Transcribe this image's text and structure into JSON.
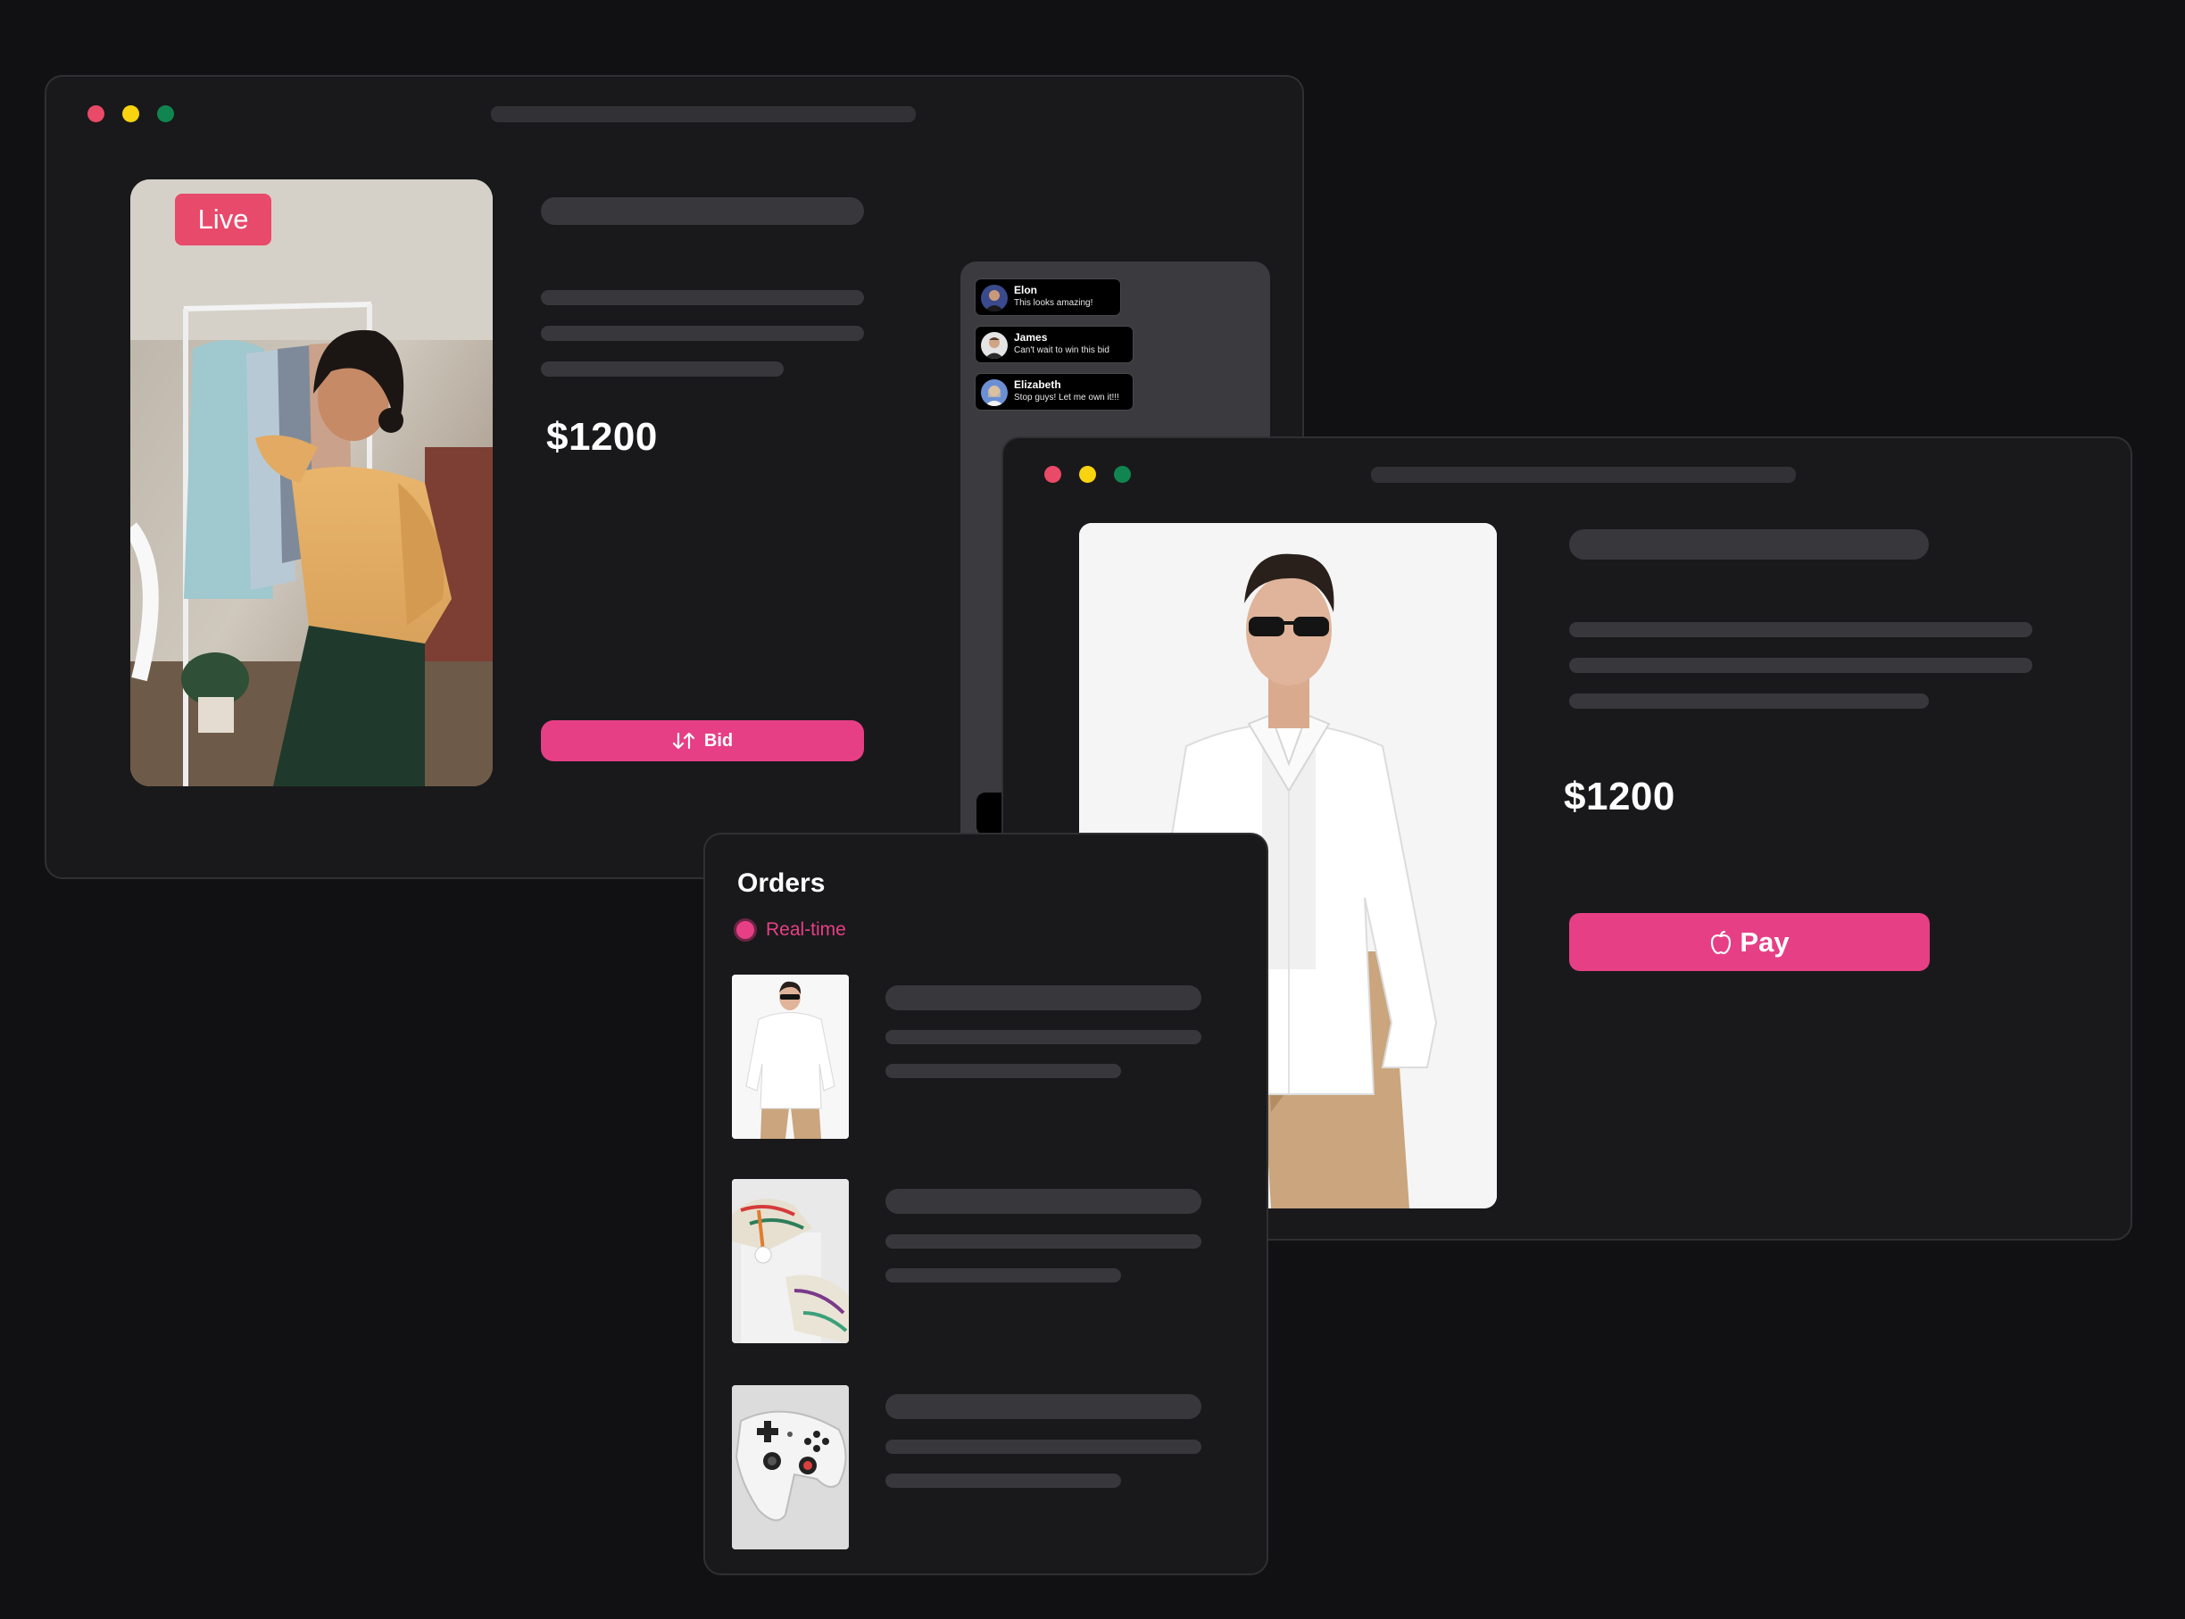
{
  "colors": {
    "background": "#111113",
    "window": "#19191b",
    "accent_pink": "#e63f86",
    "live_red": "#e84a6b",
    "dot_red": "#e94a67",
    "dot_yellow": "#f7d40f",
    "dot_green": "#11854f",
    "placeholder": "#38383c"
  },
  "live_window": {
    "live_badge": "Live",
    "price": "$1200",
    "bid_label": "Bid",
    "bid_icon": "sort-arrows-icon",
    "chat": [
      {
        "name": "Elon",
        "text": "This looks amazing!"
      },
      {
        "name": "James",
        "text": "Can't wait to win this bid"
      },
      {
        "name": "Elizabeth",
        "text": "Stop guys! Let me own it!!!"
      }
    ]
  },
  "product_window": {
    "price": "$1200",
    "pay_label": "Pay",
    "pay_icon": "apple-icon"
  },
  "orders_window": {
    "title": "Orders",
    "realtime_label": "Real-time",
    "items": [
      {
        "image": "man-white-shirt"
      },
      {
        "image": "sneakers"
      },
      {
        "image": "game-controller"
      }
    ]
  }
}
